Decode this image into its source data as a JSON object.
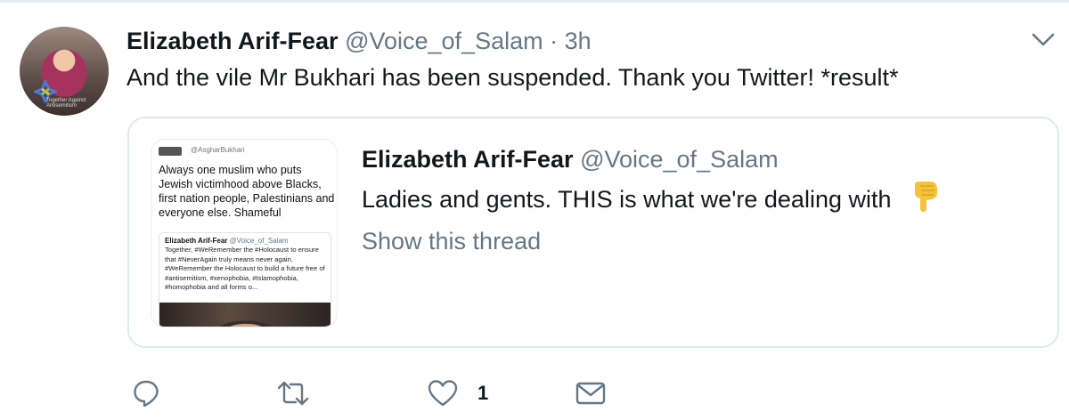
{
  "tweet": {
    "author_name": "Elizabeth Arif-Fear",
    "author_handle": "@Voice_of_Salam",
    "separator": "·",
    "time": "3h",
    "text": "And the vile Mr Bukhari has been suspended. Thank you Twitter! *result*",
    "avatar_text": "Together Against Antisemitism",
    "menu_icon": "chevron-down-icon"
  },
  "quote": {
    "author_name": "Elizabeth Arif-Fear",
    "author_handle": "@Voice_of_Salam",
    "text": "Ladies and gents. THIS is what we're dealing with",
    "emoji": "backhand-index-pointing-down",
    "show_thread": "Show this thread",
    "media": {
      "handle": "@AsgharBukhari",
      "body": "Always one muslim who puts Jewish victimhood above Blacks, first nation people, Palestinians and everyone else. Shameful",
      "inner_name": "Elizabeth Arif-Fear",
      "inner_handle": "@Voice_of_Salam",
      "inner_text": "Together, #WeRemember the #Holocaust to ensure that #NeverAgain truly means never again. #WeRemember the Holocaust to build a future free of #antisemitism, #xenophobia, #Islamophobia, #homophobia and all forms o..."
    }
  },
  "actions": {
    "reply_icon": "reply-icon",
    "retweet_icon": "retweet-icon",
    "like_icon": "heart-icon",
    "like_count": "1",
    "dm_icon": "envelope-icon"
  },
  "colors": {
    "text": "#14171a",
    "secondary": "#657786",
    "border": "#e1e8ed",
    "emoji": "#f5c33b"
  }
}
